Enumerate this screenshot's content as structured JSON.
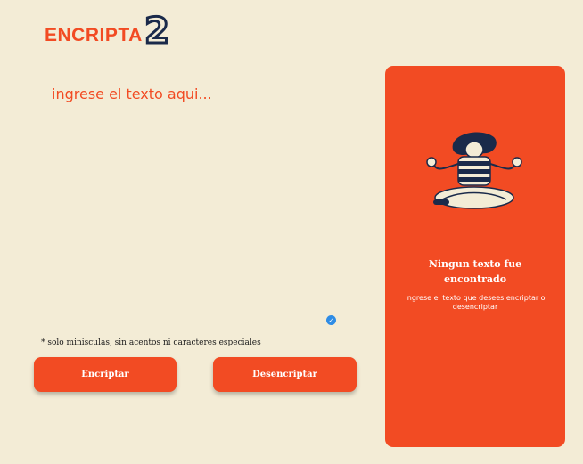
{
  "header": {
    "logo_text": "ENCRIPTA",
    "logo_mark": "2"
  },
  "editor": {
    "placeholder": "ingrese el texto aqui..."
  },
  "hint": "* solo minisculas, sin acentos ni caracteres especiales",
  "buttons": {
    "encrypt": "Encriptar",
    "decrypt": "Desencriptar"
  },
  "result_panel": {
    "title": "Ningun texto fue encontrado",
    "subtitle": "Ingrese el texto que desees encriptar o desencriptar"
  },
  "colors": {
    "background": "#f3ecd6",
    "accent": "#f24b23",
    "ink": "#1a2a4a"
  }
}
